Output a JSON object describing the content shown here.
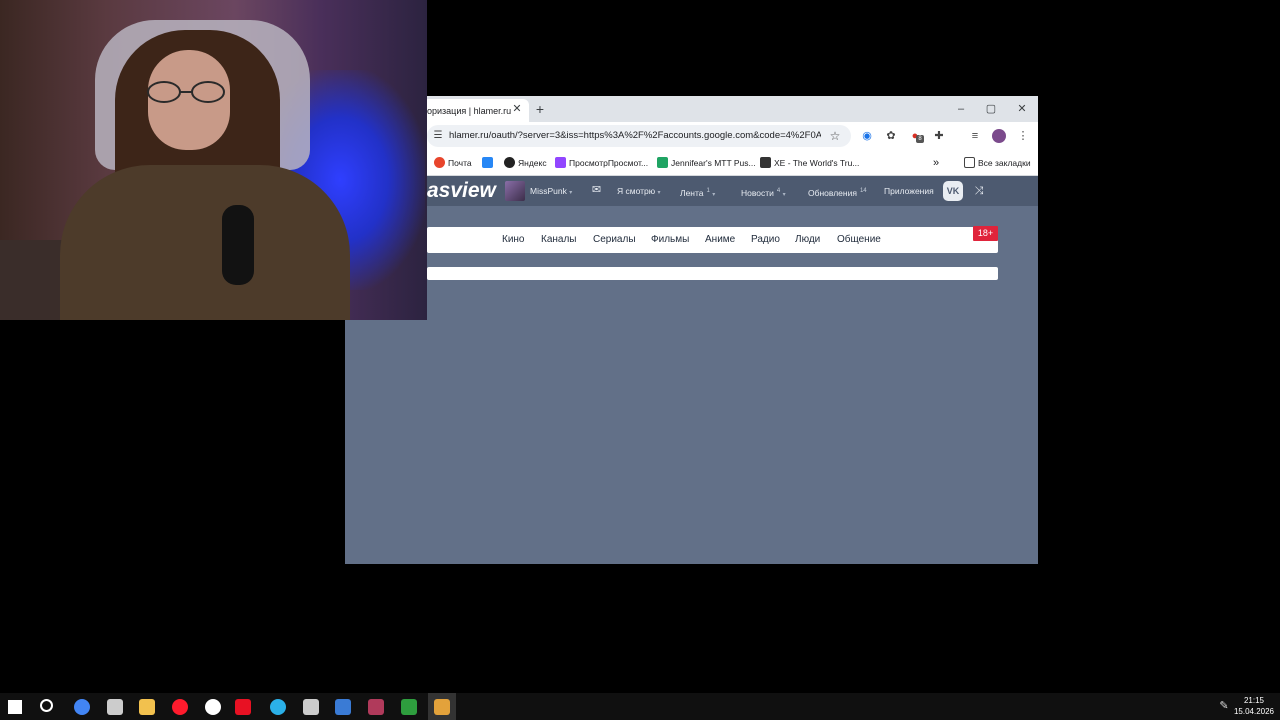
{
  "browser": {
    "tab": {
      "title": "оризация | hlamer.ru",
      "close": "✕"
    },
    "new_tab": "+",
    "window_controls": {
      "minimize": "–",
      "maximize": "▢",
      "close": "✕"
    },
    "omnibox": {
      "site_info_icon": "tune-icon",
      "url": "hlamer.ru/oauth/?server=3&iss=https%3A%2F%2Faccounts.google.com&code=4%2F0A..."
    },
    "toolbar_icons": [
      "bookmark-star-icon",
      "extension-1-icon",
      "extension-2-icon",
      "extension-3-icon",
      "extensions-puzzle-icon",
      "media-icon",
      "profile-icon",
      "menu-icon"
    ],
    "extension_badge": "8",
    "bookmarks": [
      {
        "label": "Почта",
        "color": "#e8452c"
      },
      {
        "label": "",
        "color": "#2787f5"
      },
      {
        "label": "Яндекс",
        "color": "#222222"
      },
      {
        "label": "ПросмотрПросмот...",
        "color": "#9146ff"
      },
      {
        "label": "Jennifear's MTT Pus...",
        "color": "#1fa463"
      },
      {
        "label": "XE - The World's Tru...",
        "color": "#333333"
      }
    ],
    "bookmarks_more": "»",
    "all_bookmarks": "Все закладки"
  },
  "site": {
    "logo": "asview",
    "user": "MissPunk",
    "nav": [
      {
        "label": "Я смотрю",
        "badge": ""
      },
      {
        "label": "Лента",
        "badge": "1"
      },
      {
        "label": "Новости",
        "badge": "4"
      },
      {
        "label": "Обновления",
        "badge": "14"
      },
      {
        "label": "Приложения",
        "badge": ""
      }
    ],
    "vk_label": "VK",
    "categories": [
      "Кино",
      "Каналы",
      "Сериалы",
      "Фильмы",
      "Аниме",
      "Радио",
      "Люди",
      "Общение"
    ],
    "age_badge": "18+"
  },
  "taskbar": {
    "apps": [
      {
        "name": "start-icon",
        "color": "#ffffff"
      },
      {
        "name": "search-icon",
        "color": "#ffffff"
      },
      {
        "name": "chrome-icon",
        "color": "#4285f4"
      },
      {
        "name": "obs-icon",
        "color": "#cccccc"
      },
      {
        "name": "file-explorer-icon",
        "color": "#f2c14e"
      },
      {
        "name": "opera-icon",
        "color": "#ff1b2d"
      },
      {
        "name": "yandex-browser-icon",
        "color": "#ffffff"
      },
      {
        "name": "app-red-icon",
        "color": "#e81123"
      },
      {
        "name": "edge-icon",
        "color": "#2bb0e8"
      },
      {
        "name": "word-icon",
        "color": "#cccccc"
      },
      {
        "name": "chart-app-icon",
        "color": "#3a7bd5"
      },
      {
        "name": "app-purple-icon",
        "color": "#b03a5b"
      },
      {
        "name": "app-green-icon",
        "color": "#2e9e3e"
      },
      {
        "name": "app-active-icon",
        "color": "#e3a23b"
      }
    ],
    "time": "21:15",
    "date": "15.04.2026"
  }
}
